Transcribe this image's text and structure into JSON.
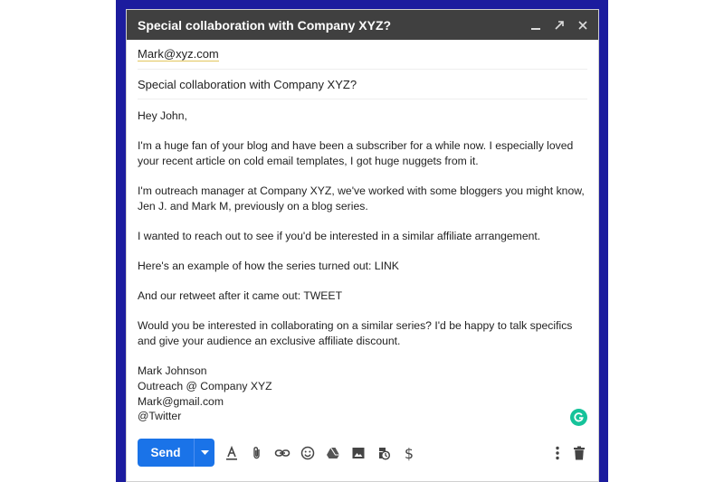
{
  "window": {
    "title": "Special collaboration with Company XYZ?",
    "controls": [
      "minimize-icon",
      "expand-icon",
      "close-icon"
    ]
  },
  "to": {
    "value": "Mark@xyz.com"
  },
  "subject": {
    "value": "Special collaboration with Company XYZ?"
  },
  "body": {
    "greeting": "Hey John,",
    "paragraphs": [
      "I'm a huge fan of your blog and have been a subscriber for a while now. I especially loved your recent article on cold email templates, I got huge nuggets from it.",
      "I'm outreach manager at Company XYZ, we've worked with some bloggers you might know, Jen J. and Mark M, previously on a blog series.",
      "I wanted to reach out to see if you'd be interested in a similar affiliate arrangement.",
      "Here's an example of how the series turned out: LINK",
      "And our retweet after it came out: TWEET",
      "Would you be interested in collaborating on a similar series? I'd be happy to talk specifics and give your audience an exclusive affiliate discount."
    ],
    "signature": [
      "Mark Johnson",
      "Outreach @ Company XYZ",
      "Mark@gmail.com",
      "@Twitter"
    ]
  },
  "toolbar": {
    "send_label": "Send",
    "tools": [
      "format-text-icon",
      "attach-icon",
      "link-icon",
      "emoji-icon",
      "drive-icon",
      "photo-icon",
      "confidential-icon",
      "dollar-icon",
      "more-options-icon",
      "trash-icon"
    ],
    "dollar_symbol": "$"
  },
  "colors": {
    "frame": "#1c1c9e",
    "titlebar": "#404040",
    "send_button": "#1a73e8",
    "grammarly": "#15c39a"
  }
}
